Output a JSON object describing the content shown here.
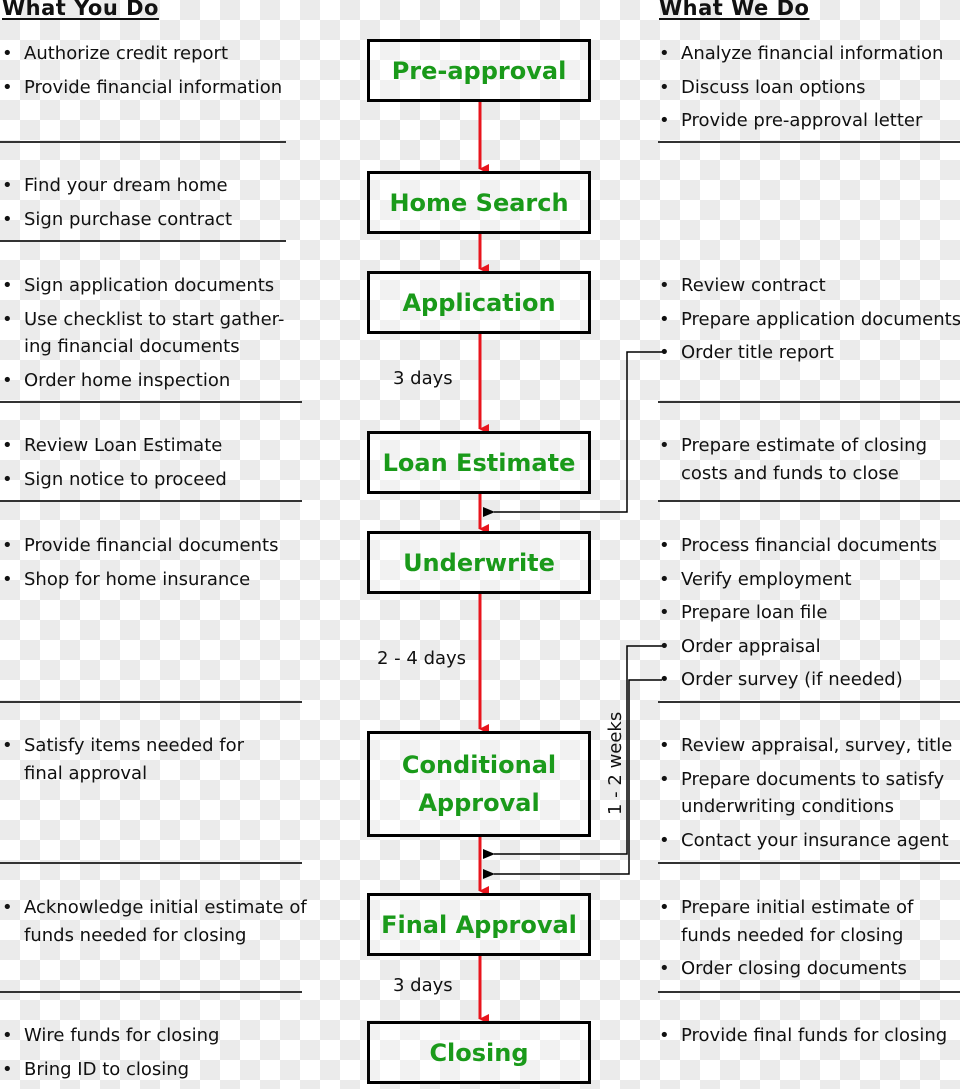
{
  "headers": {
    "left": "What You Do",
    "right": "What We Do"
  },
  "steps": [
    {
      "title": "Pre-approval"
    },
    {
      "title": "Home Search"
    },
    {
      "title": "Application"
    },
    {
      "title": "Loan Estimate"
    },
    {
      "title": "Underwrite"
    },
    {
      "title": "Conditional Approval"
    },
    {
      "title": "Final Approval"
    },
    {
      "title": "Closing"
    }
  ],
  "you_do": [
    [
      "Authorize credit report",
      "Provide financial information"
    ],
    [
      "Find your dream home",
      "Sign purchase contract"
    ],
    [
      "Sign application documents",
      "Use checklist to start gather-ing financial documents",
      "Order home inspection"
    ],
    [
      "Review Loan Estimate",
      "Sign notice to proceed"
    ],
    [
      "Provide financial documents",
      "Shop for home insurance"
    ],
    [
      "Satisfy items needed for final approval"
    ],
    [
      "Acknowledge initial estimate of funds needed for closing"
    ],
    [
      "Wire funds for closing",
      "Bring ID to closing"
    ]
  ],
  "we_do": [
    [
      "Analyze financial information",
      "Discuss loan options",
      "Provide pre-approval letter"
    ],
    [],
    [
      "Review contract",
      "Prepare application documents",
      "Order title report"
    ],
    [
      "Prepare estimate of closing costs and funds to close"
    ],
    [
      "Process financial documents",
      "Verify employment",
      "Prepare loan file",
      "Order appraisal",
      "Order survey (if needed)"
    ],
    [
      "Review appraisal, survey, title",
      "Prepare documents to satisfy underwriting conditions",
      "Contact your insurance agent"
    ],
    [
      "Prepare initial estimate of funds needed for closing",
      "Order closing documents"
    ],
    [
      "Provide final funds for closing"
    ]
  ],
  "durations": {
    "application_to_estimate": "3 days",
    "underwrite_to_conditional": "2 - 4 days",
    "appraisal_survey": "1 - 2 weeks",
    "final_to_closing": "3 days"
  },
  "colors": {
    "step_text": "#1a9a1a",
    "flow_arrow": "#e8141c",
    "border": "#000000"
  }
}
